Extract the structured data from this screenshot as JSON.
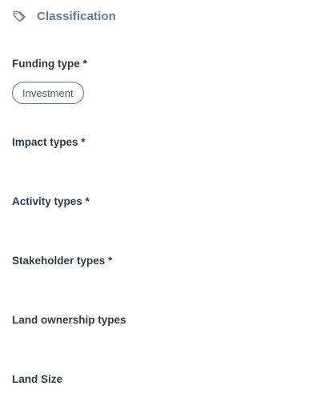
{
  "section": {
    "icon": "tag-icon",
    "title": "Classification"
  },
  "fields": {
    "funding_type": {
      "label": "Funding type *",
      "selected_chip": "Investment"
    },
    "impact_types": {
      "label": "Impact types *"
    },
    "activity_types": {
      "label": "Activity types *"
    },
    "stakeholder_types": {
      "label": "Stakeholder types *"
    },
    "land_ownership_types": {
      "label": "Land ownership types"
    },
    "land_size": {
      "label": "Land Size"
    }
  },
  "colors": {
    "section_title": "#5e7a8c",
    "label": "#2f3b45",
    "chip_border": "#5c6d78"
  }
}
